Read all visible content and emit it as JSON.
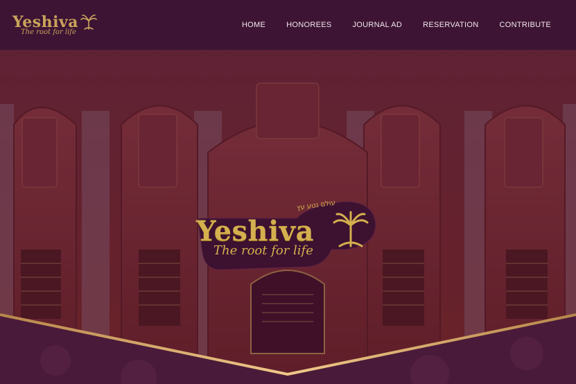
{
  "brand": {
    "name": "Yeshiva",
    "tagline": "The root for life",
    "hebrew_arc": "עולם נטע עץ"
  },
  "nav": {
    "items": [
      {
        "label": "HOME"
      },
      {
        "label": "HONOREES"
      },
      {
        "label": "JOURNAL AD"
      },
      {
        "label": "RESERVATION"
      },
      {
        "label": "CONTRIBUTE"
      }
    ]
  },
  "hero": {
    "logo_word": "Yeshiva",
    "logo_tagline": "The root for life"
  },
  "colors": {
    "header_bg": "#3d1434",
    "gold": "#c9a45a",
    "nav_text": "#f3e8ee",
    "plum": "#4a1a3a"
  },
  "icons": [
    "palm-tree-icon"
  ]
}
